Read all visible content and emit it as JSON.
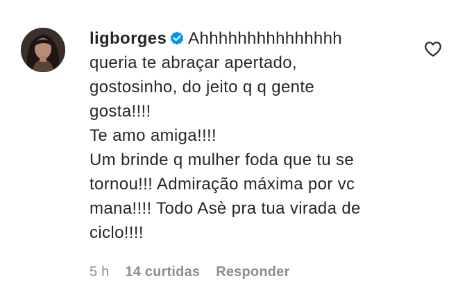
{
  "comment": {
    "username": "ligborges",
    "first_line": "Ahhhhhhhhhhhhhhh",
    "lines": [
      "queria te abraçar apertado,",
      "gostosinho, do jeito q q gente",
      "gosta!!!!",
      "Te amo amiga!!!!",
      "Um brinde q mulher foda que tu se",
      "tornou!!! Admiração máxima por vc",
      "mana!!!! Todo Asè pra tua virada de",
      "ciclo!!!!"
    ],
    "time": "5 h",
    "likes": "14 curtidas",
    "reply": "Responder"
  },
  "icons": {
    "verified": "verified-badge-icon",
    "like": "heart-outline-icon"
  },
  "colors": {
    "text": "#262626",
    "secondary": "#8e8e8e",
    "verified": "#0095f6"
  }
}
